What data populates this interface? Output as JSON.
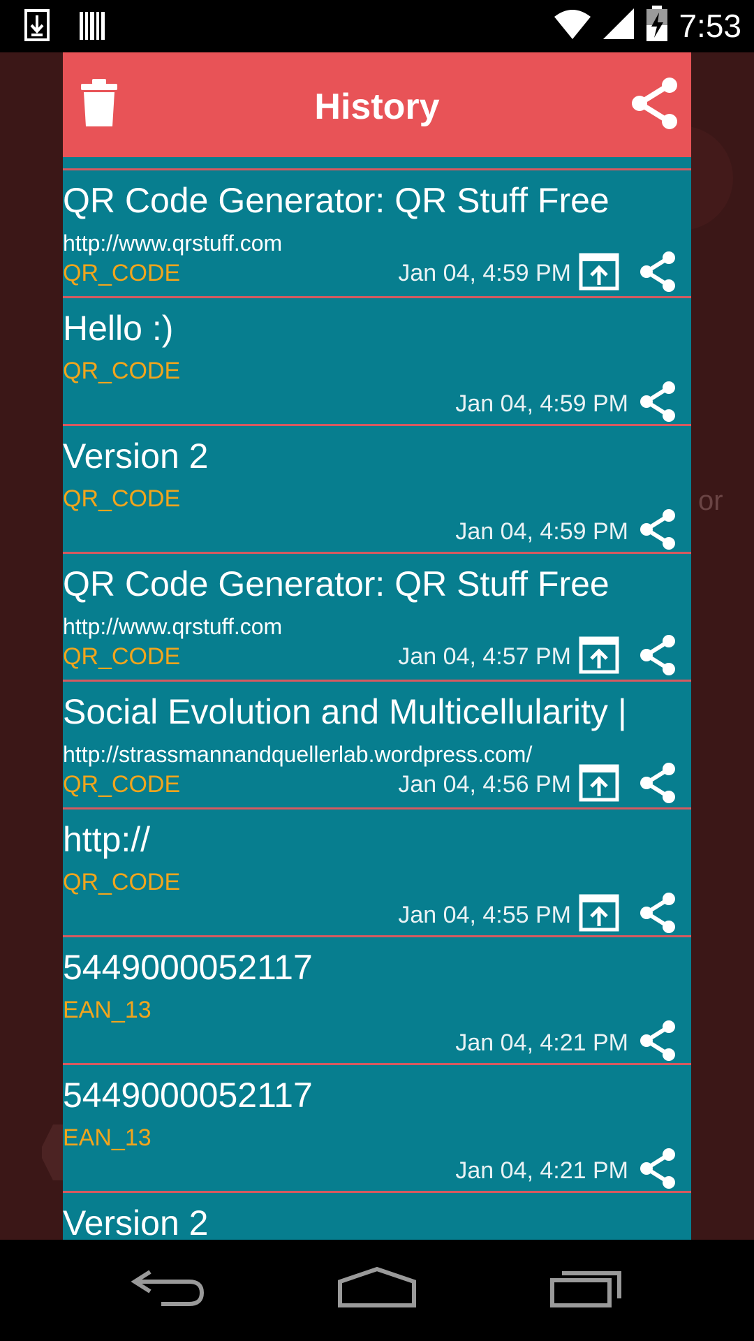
{
  "status_bar": {
    "time": "7:53"
  },
  "dialog": {
    "title": "History"
  },
  "background": {
    "partial_text": "or"
  },
  "history": [
    {
      "title": "QR Code Generator: QR Stuff Free",
      "url": "http://www.qrstuff.com",
      "type": "QR_CODE",
      "time": "Jan 04, 4:59 PM",
      "has_open": true
    },
    {
      "title": "Hello :)",
      "url": "",
      "type": "QR_CODE",
      "time": "Jan 04, 4:59 PM",
      "has_open": false
    },
    {
      "title": "Version 2",
      "url": "",
      "type": "QR_CODE",
      "time": "Jan 04, 4:59 PM",
      "has_open": false
    },
    {
      "title": "QR Code Generator: QR Stuff Free",
      "url": "http://www.qrstuff.com",
      "type": "QR_CODE",
      "time": "Jan 04, 4:57 PM",
      "has_open": true
    },
    {
      "title": "Social Evolution and Multicellularity |",
      "url": "http://strassmannandquellerlab.wordpress.com/",
      "type": "QR_CODE",
      "time": "Jan 04, 4:56 PM",
      "has_open": true
    },
    {
      "title": "http://",
      "url": "",
      "type": "QR_CODE",
      "time": "Jan 04, 4:55 PM",
      "has_open": true
    },
    {
      "title": "5449000052117",
      "url": "",
      "type": "EAN_13",
      "time": "Jan 04, 4:21 PM",
      "has_open": false
    },
    {
      "title": "5449000052117",
      "url": "",
      "type": "EAN_13",
      "time": "Jan 04, 4:21 PM",
      "has_open": false
    },
    {
      "title": "Version 2",
      "url": "",
      "type": "",
      "time": "",
      "has_open": false
    }
  ],
  "colors": {
    "header": "#e85357",
    "list_bg": "#077e8f",
    "divider": "#d55a60",
    "type_text": "#f2a51c"
  },
  "icons": {
    "delete": "trash-icon",
    "share": "share-icon",
    "open": "open-external-icon",
    "back": "back-icon",
    "home": "home-icon",
    "recents": "recents-icon"
  }
}
